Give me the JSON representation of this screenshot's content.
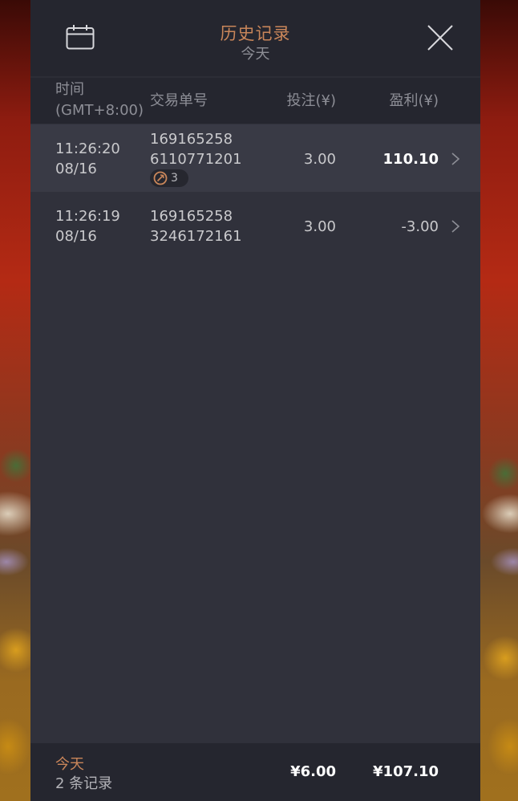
{
  "header": {
    "title": "历史记录",
    "subtitle": "今天"
  },
  "columns": {
    "time_line1": "时间",
    "time_line2": "(GMT+8:00)",
    "order": "交易单号",
    "bet": "投注(¥)",
    "profit": "盈利(¥)"
  },
  "rows": [
    {
      "time": "11:26:20",
      "date": "08/16",
      "order_line1": "169165258",
      "order_line2": "6110771201",
      "bet": "3.00",
      "profit": "110.10",
      "badge_count": "3"
    },
    {
      "time": "11:26:19",
      "date": "08/16",
      "order_line1": "169165258",
      "order_line2": "3246172161",
      "bet": "3.00",
      "profit": "-3.00"
    }
  ],
  "footer": {
    "period": "今天",
    "record_count": "2 条记录",
    "total_bet": "¥6.00",
    "total_profit": "¥107.10"
  },
  "icons": {
    "calendar": "calendar-icon",
    "close": "close-icon",
    "chevron": "chevron-right-icon",
    "free_spin": "free-spin-icon"
  },
  "colors": {
    "accent": "#c9865a",
    "panel": "#30313b",
    "header": "#25262f"
  }
}
